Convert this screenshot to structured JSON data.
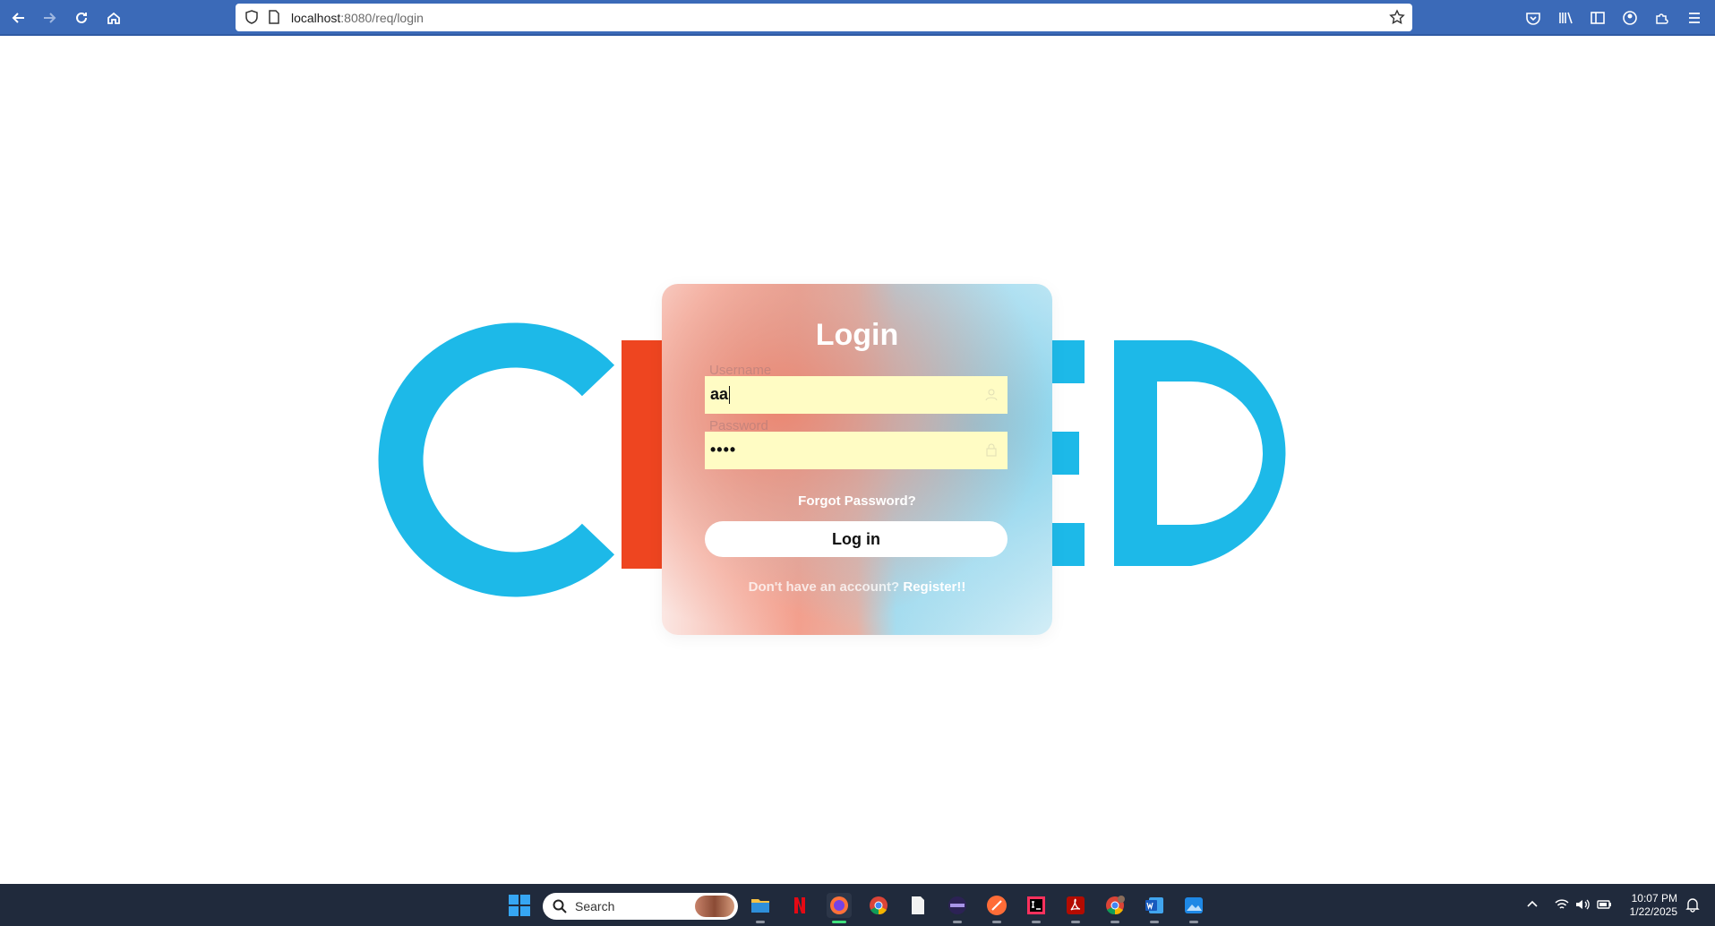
{
  "browser": {
    "url_host": "localhost",
    "url_rest": ":8080/req/login"
  },
  "background_logo": {
    "letters": [
      "C",
      "D"
    ],
    "colors": {
      "blue": "#1db9e8",
      "red": "#ee4520"
    }
  },
  "login": {
    "title": "Login",
    "username_label": "Username",
    "username_value": "aa",
    "password_label": "Password",
    "password_value": "••••",
    "forgot_link": "Forgot Password?",
    "submit_label": "Log in",
    "register_prompt": "Don't have an account?",
    "register_link": "Register!!"
  },
  "taskbar": {
    "search_label": "Search",
    "time": "10:07 PM",
    "date": "1/22/2025",
    "apps": [
      "file-explorer-icon",
      "netflix-icon",
      "firefox-icon",
      "chrome-icon",
      "notepad-icon",
      "eclipse-icon",
      "postman-icon",
      "intellij-icon",
      "acrobat-icon",
      "chrome-profile-icon",
      "word-icon",
      "photos-icon"
    ]
  }
}
